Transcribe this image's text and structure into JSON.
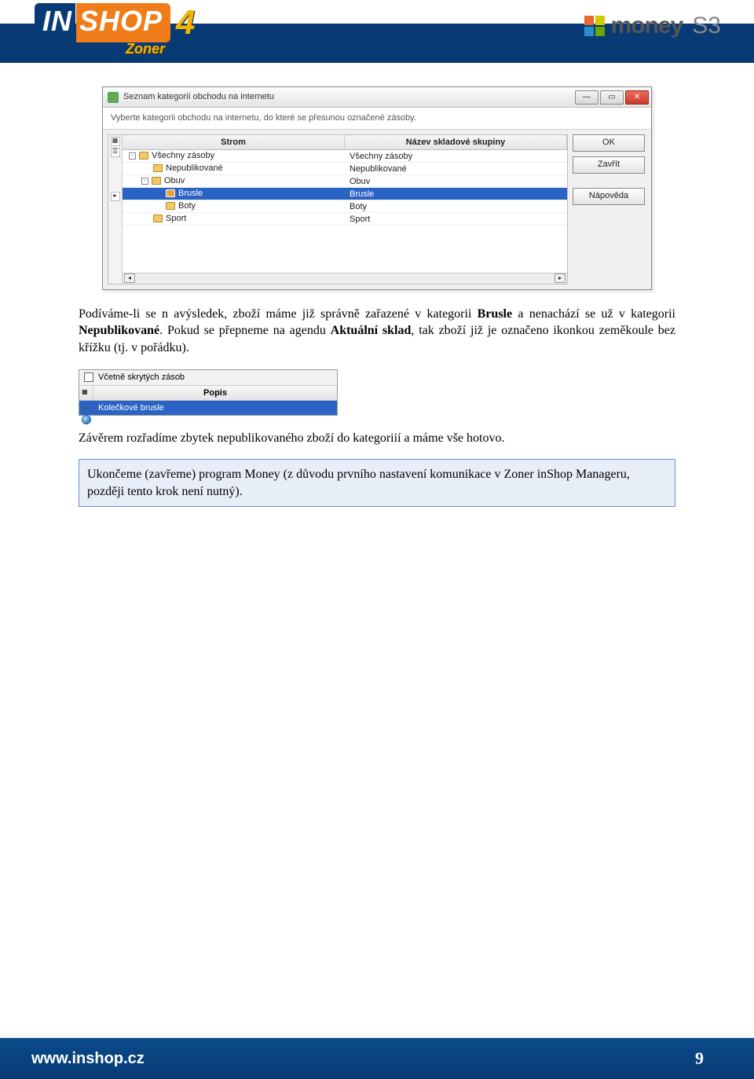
{
  "header": {
    "inshop_logo_in": "IN",
    "inshop_logo_shop": "SHOP",
    "inshop_logo_four": "4",
    "inshop_sub": "Zoner",
    "money_text": "money",
    "money_s3": "S3"
  },
  "dialog1": {
    "title": "Seznam kategorií obchodu na internetu",
    "subtitle": "Vyberte kategorii obchodu na internetu, do které se přesunou označené zásoby.",
    "buttons": {
      "ok": "OK",
      "close": "Zavřít",
      "help": "Nápověda"
    },
    "columns": {
      "tree": "Strom",
      "name": "Název skladové skupiny"
    },
    "rows": [
      {
        "indent": 0,
        "exp": "-",
        "label": "Všechny zásoby",
        "name": "Všechny zásoby",
        "selected": false
      },
      {
        "indent": 1,
        "exp": "",
        "label": "Nepublikované",
        "name": "Nepublikované",
        "selected": false
      },
      {
        "indent": 1,
        "exp": "-",
        "label": "Obuv",
        "name": "Obuv",
        "selected": false
      },
      {
        "indent": 2,
        "exp": "",
        "label": "Brusle",
        "name": "Brusle",
        "selected": true
      },
      {
        "indent": 2,
        "exp": "",
        "label": "Boty",
        "name": "Boty",
        "selected": false
      },
      {
        "indent": 1,
        "exp": "",
        "label": "Sport",
        "name": "Sport",
        "selected": false
      }
    ]
  },
  "para1": {
    "t1": "Podíváme-li se n avýsledek, zboží máme již správně zařazené v kategorii ",
    "b1": "Brusle",
    "t2": " a nenachází se už v kategorii ",
    "b2": "Nepublikované",
    "t3": ". Pokud se přepneme na agendu ",
    "b3": "Aktuální sklad",
    "t4": ", tak zboží již je označeno ikonkou zeměkoule bez křížku (tj. v pořádku)."
  },
  "panel2": {
    "check_label": "Včetně skrytých zásob",
    "column": "Popis",
    "row_value": "Kolečkové brusle"
  },
  "para2": "Závěrem rozřadíme zbytek nepublikovaného zboží do kategoriií a máme vše hotovo.",
  "callout": "Ukončeme (zavřeme) program Money (z důvodu prvního nastavení komunikace v Zoner inShop Manageru, později tento krok není nutný).",
  "footer": {
    "url": "www.inshop.cz",
    "page": "9"
  }
}
